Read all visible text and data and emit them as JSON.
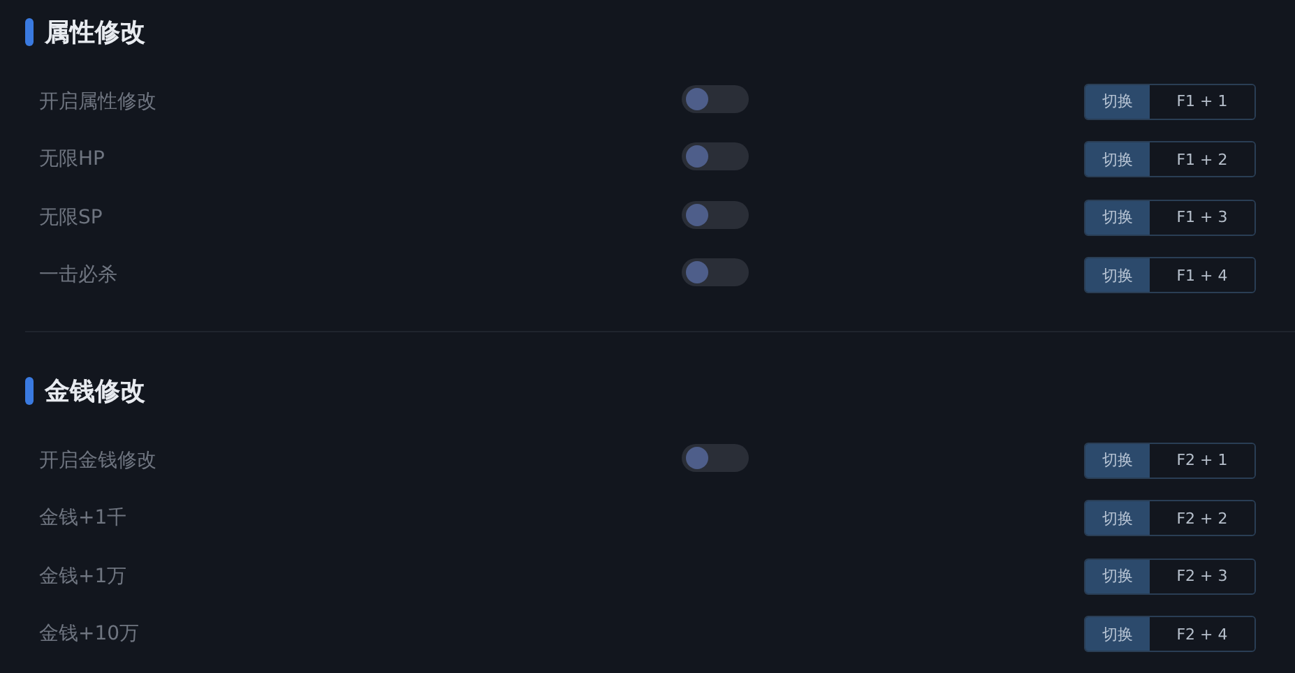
{
  "sections": [
    {
      "title": "属性修改",
      "rows": [
        {
          "kind": "toggle",
          "label": "开启属性修改",
          "on": false,
          "action": "切换",
          "hotkey": "F1 + 1"
        },
        {
          "kind": "toggle",
          "label": "无限HP",
          "on": false,
          "action": "切换",
          "hotkey": "F1 + 2"
        },
        {
          "kind": "toggle",
          "label": "无限SP",
          "on": false,
          "action": "切换",
          "hotkey": "F1 + 3"
        },
        {
          "kind": "toggle",
          "label": "一击必杀",
          "on": false,
          "action": "切换",
          "hotkey": "F1 + 4"
        }
      ]
    },
    {
      "title": "金钱修改",
      "rows": [
        {
          "kind": "toggle",
          "label": "开启金钱修改",
          "on": false,
          "action": "切换",
          "hotkey": "F2 + 1"
        },
        {
          "kind": "action",
          "label": "金钱+1千",
          "action": "切换",
          "hotkey": "F2 + 2"
        },
        {
          "kind": "action",
          "label": "金钱+1万",
          "action": "切换",
          "hotkey": "F2 + 3"
        },
        {
          "kind": "action",
          "label": "金钱+10万",
          "action": "切换",
          "hotkey": "F2 + 4"
        }
      ]
    }
  ]
}
